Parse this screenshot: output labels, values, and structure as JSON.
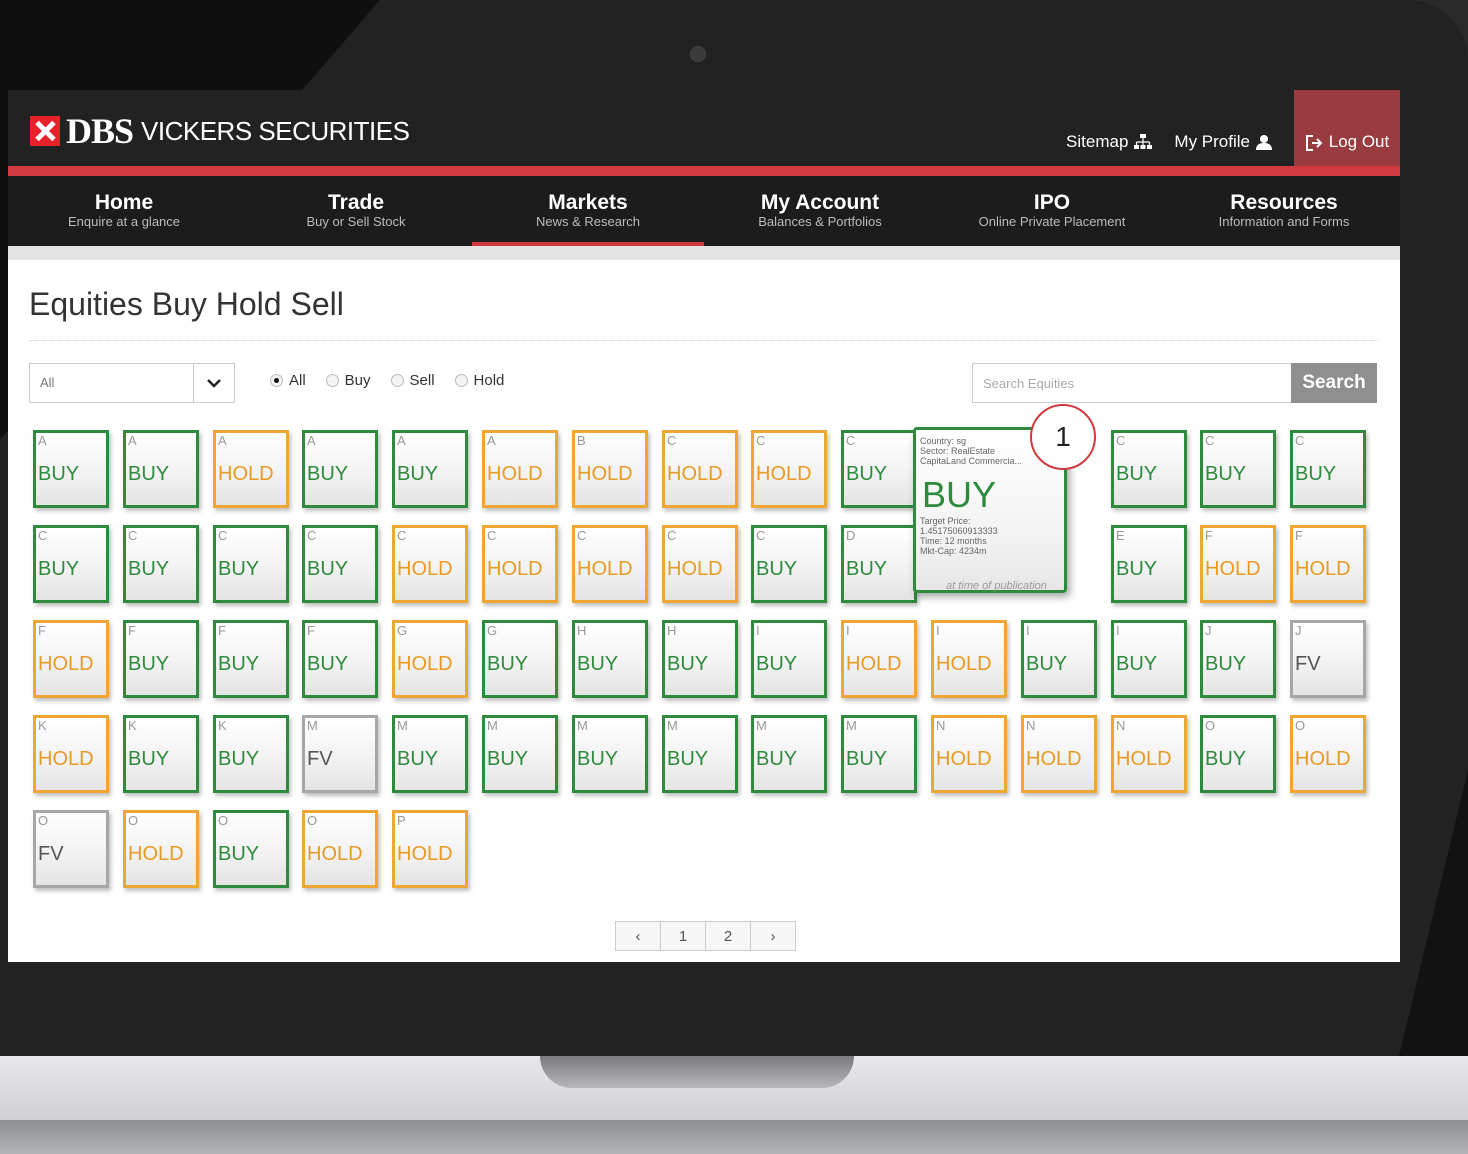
{
  "brand": {
    "name_bold": "DBS",
    "name_rest": "VICKERS SECURITIES"
  },
  "utilities": {
    "sitemap": "Sitemap",
    "profile": "My Profile",
    "logout": "Log Out"
  },
  "nav": [
    {
      "title": "Home",
      "sub": "Enquire at a glance"
    },
    {
      "title": "Trade",
      "sub": "Buy or Sell Stock"
    },
    {
      "title": "Markets",
      "sub": "News & Research"
    },
    {
      "title": "My Account",
      "sub": "Balances & Portfolios"
    },
    {
      "title": "IPO",
      "sub": "Online Private Placement"
    },
    {
      "title": "Resources",
      "sub": "Information and Forms"
    }
  ],
  "active_nav": "Markets",
  "page": {
    "title": "Equities Buy Hold Sell"
  },
  "filter": {
    "select_value": "All",
    "radios": [
      {
        "label": "All",
        "checked": true
      },
      {
        "label": "Buy",
        "checked": false
      },
      {
        "label": "Sell",
        "checked": false
      },
      {
        "label": "Hold",
        "checked": false
      }
    ]
  },
  "search": {
    "placeholder": "Search Equities",
    "button": "Search"
  },
  "tiles": [
    [
      "A",
      "BUY"
    ],
    [
      "A",
      "BUY"
    ],
    [
      "A",
      "HOLD"
    ],
    [
      "A",
      "BUY"
    ],
    [
      "A",
      "BUY"
    ],
    [
      "A",
      "HOLD"
    ],
    [
      "B",
      "HOLD"
    ],
    [
      "C",
      "HOLD"
    ],
    [
      "C",
      "HOLD"
    ],
    [
      "C",
      "BUY"
    ],
    null,
    null,
    [
      "C",
      "BUY"
    ],
    [
      "C",
      "BUY"
    ],
    [
      "C",
      "BUY"
    ],
    [
      "C",
      "BUY"
    ],
    [
      "C",
      "BUY"
    ],
    [
      "C",
      "BUY"
    ],
    [
      "C",
      "BUY"
    ],
    [
      "C",
      "HOLD"
    ],
    [
      "C",
      "HOLD"
    ],
    [
      "C",
      "HOLD"
    ],
    [
      "C",
      "HOLD"
    ],
    [
      "C",
      "BUY"
    ],
    [
      "D",
      "BUY"
    ],
    null,
    null,
    [
      "E",
      "BUY"
    ],
    [
      "F",
      "HOLD"
    ],
    [
      "F",
      "HOLD"
    ],
    [
      "F",
      "HOLD"
    ],
    [
      "F",
      "BUY"
    ],
    [
      "F",
      "BUY"
    ],
    [
      "F",
      "BUY"
    ],
    [
      "G",
      "HOLD"
    ],
    [
      "G",
      "BUY"
    ],
    [
      "H",
      "BUY"
    ],
    [
      "H",
      "BUY"
    ],
    [
      "I",
      "BUY"
    ],
    [
      "I",
      "HOLD"
    ],
    [
      "I",
      "HOLD"
    ],
    [
      "I",
      "BUY"
    ],
    [
      "I",
      "BUY"
    ],
    [
      "J",
      "BUY"
    ],
    [
      "J",
      "FV"
    ],
    [
      "K",
      "HOLD"
    ],
    [
      "K",
      "BUY"
    ],
    [
      "K",
      "BUY"
    ],
    [
      "M",
      "FV"
    ],
    [
      "M",
      "BUY"
    ],
    [
      "M",
      "BUY"
    ],
    [
      "M",
      "BUY"
    ],
    [
      "M",
      "BUY"
    ],
    [
      "M",
      "BUY"
    ],
    [
      "M",
      "BUY"
    ],
    [
      "N",
      "HOLD"
    ],
    [
      "N",
      "HOLD"
    ],
    [
      "N",
      "HOLD"
    ],
    [
      "O",
      "BUY"
    ],
    [
      "O",
      "HOLD"
    ],
    [
      "O",
      "FV"
    ],
    [
      "O",
      "HOLD"
    ],
    [
      "O",
      "BUY"
    ],
    [
      "O",
      "HOLD"
    ],
    [
      "P",
      "HOLD"
    ]
  ],
  "popup": {
    "country": "Country: sg",
    "sector": "Sector: RealEstate",
    "company": "CapitaLand Commercia...",
    "recommendation": "BUY",
    "target_label": "Target Price:",
    "target_value": "1.45175060913333",
    "time": "Time: 12 months",
    "mktcap": "Mkt-Cap: 4234m",
    "footnote": "at time of publication"
  },
  "callout": "1",
  "pagination": {
    "prev": "‹",
    "pages": [
      "1",
      "2"
    ],
    "next": "›"
  },
  "colors": {
    "buy": "#2e8a3c",
    "hold": "#f0a632",
    "fv": "#a7a7a7",
    "accent": "#d03a3e"
  }
}
